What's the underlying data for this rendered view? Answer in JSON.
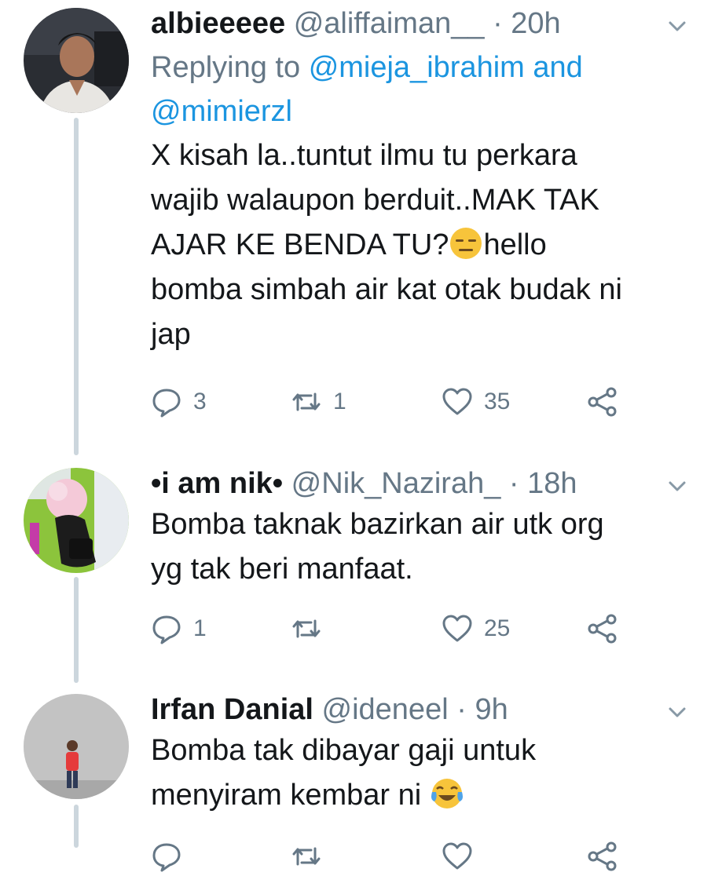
{
  "tweets": [
    {
      "display_name": "albieeeee",
      "handle": "@aliffaiman__",
      "separator": "·",
      "time": "20h",
      "replying_prefix": "Replying to",
      "replying_mentions_1": "@mieja_ibrahim and",
      "replying_mentions_2": "@mimierzl",
      "text_line_1": "X kisah la..tuntut ilmu tu perkara",
      "text_line_2": "wajib walaupon berduit..MAK TAK",
      "text_line_3a": "AJAR KE BENDA TU?",
      "text_line_3b": "hello",
      "text_line_4": "bomba simbah air kat otak budak ni",
      "text_line_5": "jap",
      "replies": "3",
      "retweets": "1",
      "likes": "35"
    },
    {
      "display_name": "•i am nik•",
      "handle": "@Nik_Nazirah_",
      "separator": "·",
      "time": "18h",
      "text_line_1": "Bomba taknak bazirkan air utk org",
      "text_line_2": "yg tak beri manfaat.",
      "replies": "1",
      "retweets": "",
      "likes": "25"
    },
    {
      "display_name": "Irfan Danial",
      "handle": "@ideneel",
      "separator": "·",
      "time": "9h",
      "text_line_1": "Bomba tak dibayar gaji untuk",
      "text_line_2": "menyiram kembar ni"
    }
  ],
  "icons": {
    "reply": "reply-icon",
    "retweet": "retweet-icon",
    "like": "heart-icon",
    "share": "share-icon",
    "more": "chevron-down-icon"
  },
  "colors": {
    "link": "#1b95e0",
    "secondary_text": "#657786",
    "thread_line": "#ccd6dd"
  }
}
